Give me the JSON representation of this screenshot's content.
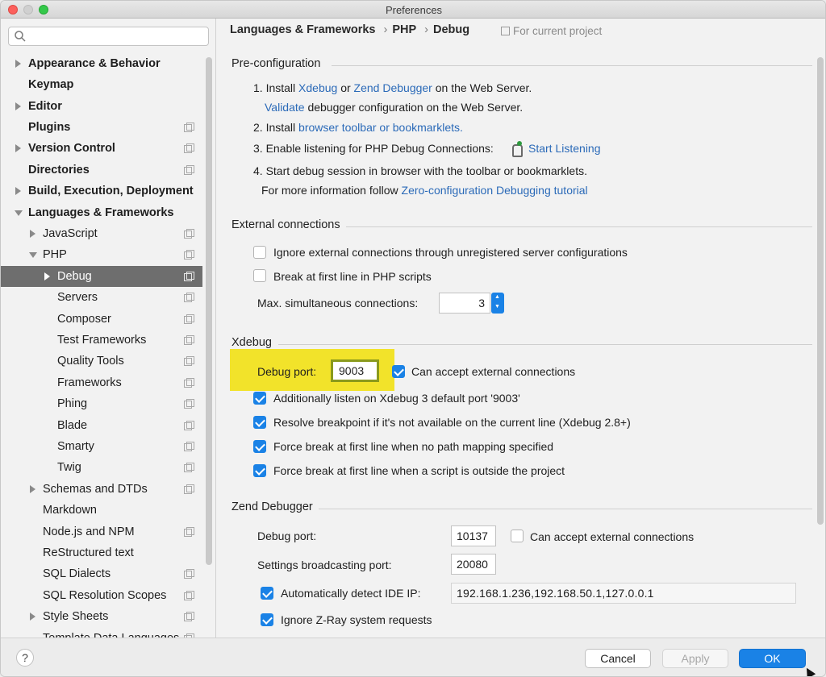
{
  "window": {
    "title": "Preferences"
  },
  "sidebar": {
    "search_placeholder": "",
    "items": [
      {
        "label": "Appearance & Behavior"
      },
      {
        "label": "Keymap"
      },
      {
        "label": "Editor"
      },
      {
        "label": "Plugins"
      },
      {
        "label": "Version Control"
      },
      {
        "label": "Directories"
      },
      {
        "label": "Build, Execution, Deployment"
      },
      {
        "label": "Languages & Frameworks"
      },
      {
        "label": "JavaScript"
      },
      {
        "label": "PHP"
      },
      {
        "label": "Debug"
      },
      {
        "label": "Servers"
      },
      {
        "label": "Composer"
      },
      {
        "label": "Test Frameworks"
      },
      {
        "label": "Quality Tools"
      },
      {
        "label": "Frameworks"
      },
      {
        "label": "Phing"
      },
      {
        "label": "Blade"
      },
      {
        "label": "Smarty"
      },
      {
        "label": "Twig"
      },
      {
        "label": "Schemas and DTDs"
      },
      {
        "label": "Markdown"
      },
      {
        "label": "Node.js and NPM"
      },
      {
        "label": "ReStructured text"
      },
      {
        "label": "SQL Dialects"
      },
      {
        "label": "SQL Resolution Scopes"
      },
      {
        "label": "Style Sheets"
      },
      {
        "label": "Template Data Languages"
      }
    ]
  },
  "header": {
    "crumbs": [
      "Languages & Frameworks",
      "PHP",
      "Debug"
    ],
    "separator": "›",
    "for_project": "For current project"
  },
  "preconfig": {
    "title": "Pre-configuration",
    "step1_a": "1. Install",
    "step1_xdebug": "Xdebug",
    "step1_or": "or",
    "step1_zend": "Zend Debugger",
    "step1_b": "on the Web Server.",
    "validate_link": "Validate",
    "validate_text": "debugger configuration on the Web Server.",
    "step2_a": "2. Install",
    "step2_link": "browser toolbar or bookmarklets.",
    "step3_a": "3. Enable listening for PHP Debug Connections:",
    "step3_link": "Start Listening",
    "step4": "4. Start debug session in browser with the toolbar or bookmarklets.",
    "more_a": "For more information follow",
    "more_link": "Zero-configuration Debugging tutorial"
  },
  "external": {
    "title": "External connections",
    "ignore_label": "Ignore external connections through unregistered server configurations",
    "ignore_checked": false,
    "break_label": "Break at first line in PHP scripts",
    "break_checked": false,
    "max_label": "Max. simultaneous connections:",
    "max_value": "3"
  },
  "xdebug": {
    "title": "Xdebug",
    "port_label": "Debug port:",
    "port_value": "9003",
    "accept_label": "Can accept external connections",
    "accept_checked": true,
    "opt1": "Additionally listen on Xdebug 3 default port '9003'",
    "opt2": "Resolve breakpoint if it's not available on the current line (Xdebug 2.8+)",
    "opt3": "Force break at first line when no path mapping specified",
    "opt4": "Force break at first line when a script is outside the project",
    "highlight_color": "#f2e32a"
  },
  "zend": {
    "title": "Zend Debugger",
    "port_label": "Debug port:",
    "port_value": "10137",
    "accept_label": "Can accept external connections",
    "accept_checked": false,
    "broadcast_label": "Settings broadcasting port:",
    "broadcast_value": "20080",
    "detect_label": "Automatically detect IDE IP:",
    "detect_checked": true,
    "detect_value": "192.168.1.236,192.168.50.1,127.0.0.1",
    "ignore_label": "Ignore Z-Ray system requests",
    "ignore_checked": true
  },
  "footer": {
    "help": "?",
    "cancel": "Cancel",
    "apply": "Apply",
    "ok": "OK"
  },
  "colors": {
    "accent": "#1a82e6",
    "link": "#2b6ab8",
    "selected": "#6e6e6e"
  }
}
